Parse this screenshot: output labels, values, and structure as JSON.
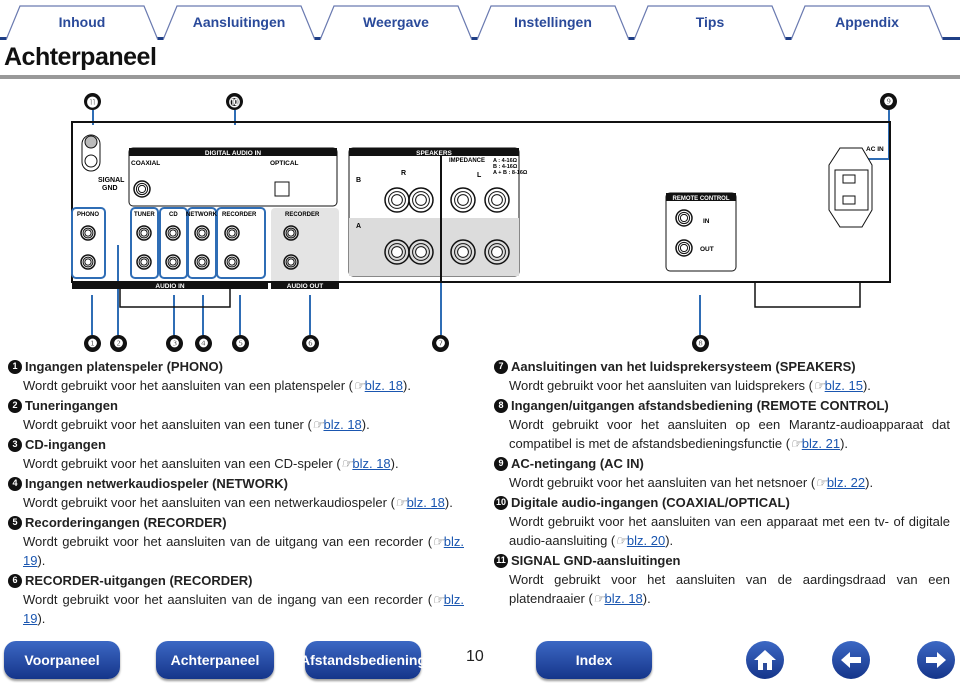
{
  "tabs": [
    "Inhoud",
    "Aansluitingen",
    "Weergave",
    "Instellingen",
    "Tips",
    "Appendix"
  ],
  "page_title": "Achterpaneel",
  "panel": {
    "digital_audio_in": "DIGITAL AUDIO IN",
    "coaxial": "COAXIAL",
    "optical": "OPTICAL",
    "signal": "SIGNAL",
    "gnd": "GND",
    "speakers": "SPEAKERS",
    "impedance": "IMPEDANCE",
    "imp_a": "A      : 4-16Ω",
    "imp_b": "B      : 4-16Ω",
    "imp_ab": "A + B : 8-16Ω",
    "phono": "PHONO",
    "tuner": "TUNER",
    "cd": "CD",
    "network": "NETWORK",
    "recorder": "RECORDER",
    "recorder_out": "RECORDER",
    "audio_in": "AUDIO IN",
    "audio_out": "AUDIO OUT",
    "remote_control": "REMOTE CONTROL",
    "in": "IN",
    "out": "OUT",
    "ac_in": "AC IN",
    "l": "L",
    "r": "R",
    "a": "A",
    "b": "B"
  },
  "callouts_top": [
    "⓫",
    "⓾",
    "❾"
  ],
  "callouts_bottom": [
    "❶",
    "❷",
    "❸",
    "❹",
    "❺",
    "❻",
    "❼",
    "❽"
  ],
  "left_items": [
    {
      "n": "1",
      "title": "Ingangen platenspeler (PHONO)",
      "pre": "Wordt gebruikt voor het aansluiten van een platenspeler (",
      "link": "blz. 18",
      "post": ")."
    },
    {
      "n": "2",
      "title": "Tuneringangen",
      "pre": "Wordt gebruikt voor het aansluiten van een tuner (",
      "link": "blz. 18",
      "post": ")."
    },
    {
      "n": "3",
      "title": "CD-ingangen",
      "pre": "Wordt gebruikt voor het aansluiten van een CD-speler (",
      "link": "blz. 18",
      "post": ")."
    },
    {
      "n": "4",
      "title": "Ingangen netwerkaudiospeler (NETWORK)",
      "pre": "Wordt gebruikt voor het aansluiten van een netwerkaudiospeler (",
      "link": "blz. 18",
      "post": ")."
    },
    {
      "n": "5",
      "title": "Recorderingangen (RECORDER)",
      "pre": "Wordt gebruikt voor het aansluiten van de uitgang van een recorder (",
      "link": "blz. 19",
      "post": ")."
    },
    {
      "n": "6",
      "title": "RECORDER-uitgangen (RECORDER)",
      "pre": "Wordt gebruikt voor het aansluiten van de ingang van een recorder (",
      "link": "blz. 19",
      "post": ")."
    }
  ],
  "right_items": [
    {
      "n": "7",
      "title": "Aansluitingen van het luidsprekersysteem (SPEAKERS)",
      "pre": "Wordt gebruikt voor het aansluiten van luidsprekers (",
      "link": "blz. 15",
      "post": ")."
    },
    {
      "n": "8",
      "title": "Ingangen/uitgangen afstandsbediening (REMOTE CONTROL)",
      "pre": "Wordt gebruikt voor het aansluiten op een Marantz-audioapparaat dat compatibel is met de afstandsbedieningsfunctie (",
      "link": "blz. 21",
      "post": ")."
    },
    {
      "n": "9",
      "title": "AC-netingang (AC IN)",
      "pre": "Wordt gebruikt voor het aansluiten van het netsnoer (",
      "link": "blz. 22",
      "post": ")."
    },
    {
      "n": "10",
      "title": "Digitale audio-ingangen (COAXIAL/OPTICAL)",
      "pre": "Wordt gebruikt voor het aansluiten van een apparaat met een tv- of digitale audio-aansluiting (",
      "link": "blz. 20",
      "post": ")."
    },
    {
      "n": "11",
      "title": "SIGNAL GND-aansluitingen",
      "pre": "Wordt gebruikt voor het aansluiten van de aardingsdraad van een platendraaier (",
      "link": "blz. 18",
      "post": ")."
    }
  ],
  "ref_icon": "☞",
  "footer": {
    "voorpaneel": "Voorpaneel",
    "achterpaneel": "Achterpaneel",
    "afstandsbediening": "Afstandsbediening",
    "page": "10",
    "index": "Index"
  },
  "icons": {
    "home": "home-icon",
    "back": "arrow-left-icon",
    "forward": "arrow-right-icon"
  },
  "colors": {
    "accent": "#1f3f86",
    "tab_text": "#2a4a9a",
    "link": "#1a56b0",
    "callout_line": "#2f6db5"
  }
}
